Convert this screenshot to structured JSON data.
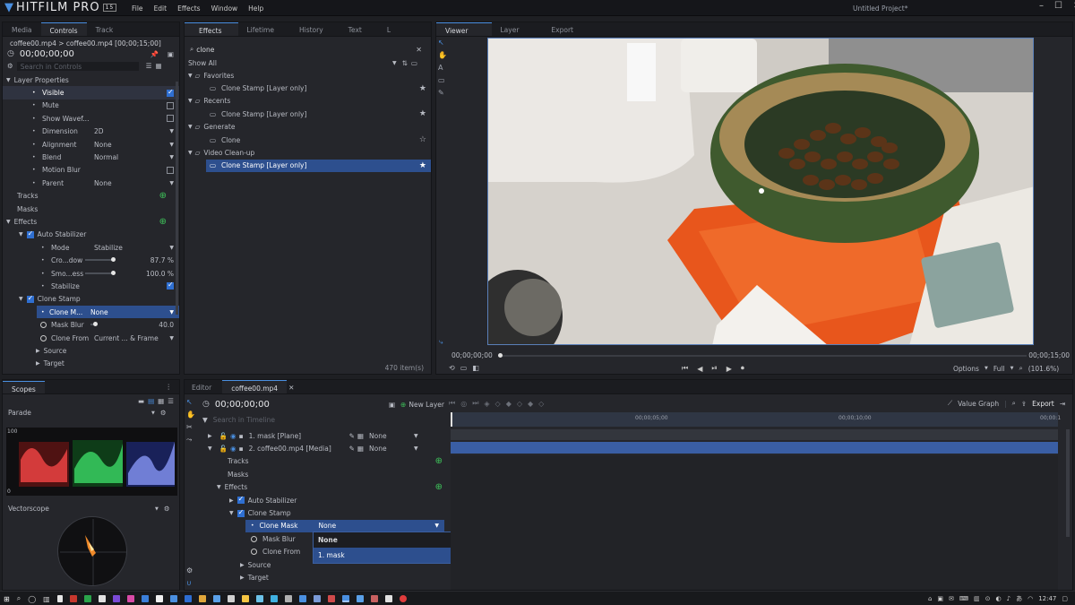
{
  "app": {
    "logo_text": "HITFILM PRO",
    "logo_badge": "15",
    "menu": [
      "File",
      "Edit",
      "Effects",
      "Window",
      "Help"
    ],
    "window_title": "Untitled Project*",
    "accent_color": "#2d4f8e"
  },
  "left_panel": {
    "tabs": [
      "Media",
      "Controls",
      "Track"
    ],
    "active_tab": "Controls",
    "breadcrumb": "coffee00.mp4 > coffee00.mp4 [00;00;15;00]",
    "timecode": "00;00;00;00",
    "search_placeholder": "Search in Controls",
    "section_layer": "Layer Properties",
    "props": [
      {
        "label": "Visible",
        "value": "",
        "control": "checkbox-on"
      },
      {
        "label": "Mute",
        "value": "",
        "control": "checkbox-off"
      },
      {
        "label": "Show Wavef...",
        "value": "",
        "control": "checkbox-off"
      },
      {
        "label": "Dimension",
        "value": "2D",
        "control": "dropdown"
      },
      {
        "label": "Alignment",
        "value": "None",
        "control": "dropdown"
      },
      {
        "label": "Blend",
        "value": "Normal",
        "control": "dropdown"
      },
      {
        "label": "Motion Blur",
        "value": "",
        "control": "checkbox-off"
      },
      {
        "label": "Parent",
        "value": "None",
        "control": "dropdown"
      }
    ],
    "tracks_label": "Tracks",
    "masks_label": "Masks",
    "effects_label": "Effects",
    "auto_stabilizer": {
      "name": "Auto Stabilizer",
      "mode_label": "Mode",
      "mode_value": "Stabilize",
      "crop_label": "Cro...dow",
      "crop_value": "87.7 %",
      "smooth_label": "Smo...ess",
      "smooth_value": "100.0 %",
      "stabilize_label": "Stabilize"
    },
    "clone_stamp": {
      "name": "Clone Stamp",
      "clone_mask_label": "Clone M...",
      "clone_mask_value": "None",
      "mask_blur_label": "Mask Blur",
      "mask_blur_value": "40.0",
      "clone_from_label": "Clone From",
      "clone_from_value": "Current ... & Frame",
      "source_label": "Source",
      "target_label": "Target"
    }
  },
  "effects_panel": {
    "tabs": [
      "Effects",
      "Lifetime",
      "History",
      "Text",
      "L"
    ],
    "active_tab": "Effects",
    "search_value": "clone",
    "filter": "Show All",
    "groups": [
      {
        "name": "Favorites",
        "items": [
          {
            "label": "Clone Stamp [Layer only]",
            "star": true,
            "selected": false
          }
        ]
      },
      {
        "name": "Recents",
        "items": [
          {
            "label": "Clone Stamp [Layer only]",
            "star": true,
            "selected": false
          }
        ]
      },
      {
        "name": "Generate",
        "items": [
          {
            "label": "Clone",
            "star": false,
            "selected": false
          }
        ]
      },
      {
        "name": "Video Clean-up",
        "items": [
          {
            "label": "Clone Stamp [Layer only]",
            "star": true,
            "selected": true
          }
        ]
      }
    ],
    "item_count": "470 item(s)"
  },
  "viewer": {
    "tabs": [
      "Viewer",
      "Layer",
      "Export"
    ],
    "active_tab": "Viewer",
    "timecode_start": "00;00;00;00",
    "timecode_end": "00;00;15;00",
    "options_label": "Options",
    "quality": "Full",
    "zoom": "(101.6%)"
  },
  "scopes": {
    "title": "Scopes",
    "parade_label": "Parade",
    "scale_top": "100",
    "scale_bottom": "0",
    "vectorscope_label": "Vectorscope"
  },
  "timeline": {
    "tabs": [
      "Editor",
      "coffee00.mp4"
    ],
    "active_tab": "coffee00.mp4",
    "timecode": "00;00;00;00",
    "new_layer": "New Layer",
    "search_placeholder": "Search in Timeline",
    "value_graph": "Value Graph",
    "export_label": "Export",
    "ruler": [
      "00;00;05;00",
      "00;00;10;00",
      "00;00:1"
    ],
    "layers": [
      {
        "name": "1. mask [Plane]",
        "blend": "None"
      },
      {
        "name": "2. coffee00.mp4 [Media]",
        "blend": "None"
      }
    ],
    "sub": {
      "tracks": "Tracks",
      "masks": "Masks",
      "effects": "Effects",
      "auto_stabilizer": "Auto Stabilizer",
      "clone_stamp": "Clone Stamp",
      "clone_mask": "Clone Mask",
      "clone_mask_value": "None",
      "mask_blur": "Mask Blur",
      "clone_from": "Clone From",
      "source": "Source",
      "target": "Target"
    },
    "dropdown_options": [
      "None",
      "1. mask"
    ],
    "dropdown_selected": "1. mask"
  },
  "taskbar": {
    "clock": "12:47"
  }
}
